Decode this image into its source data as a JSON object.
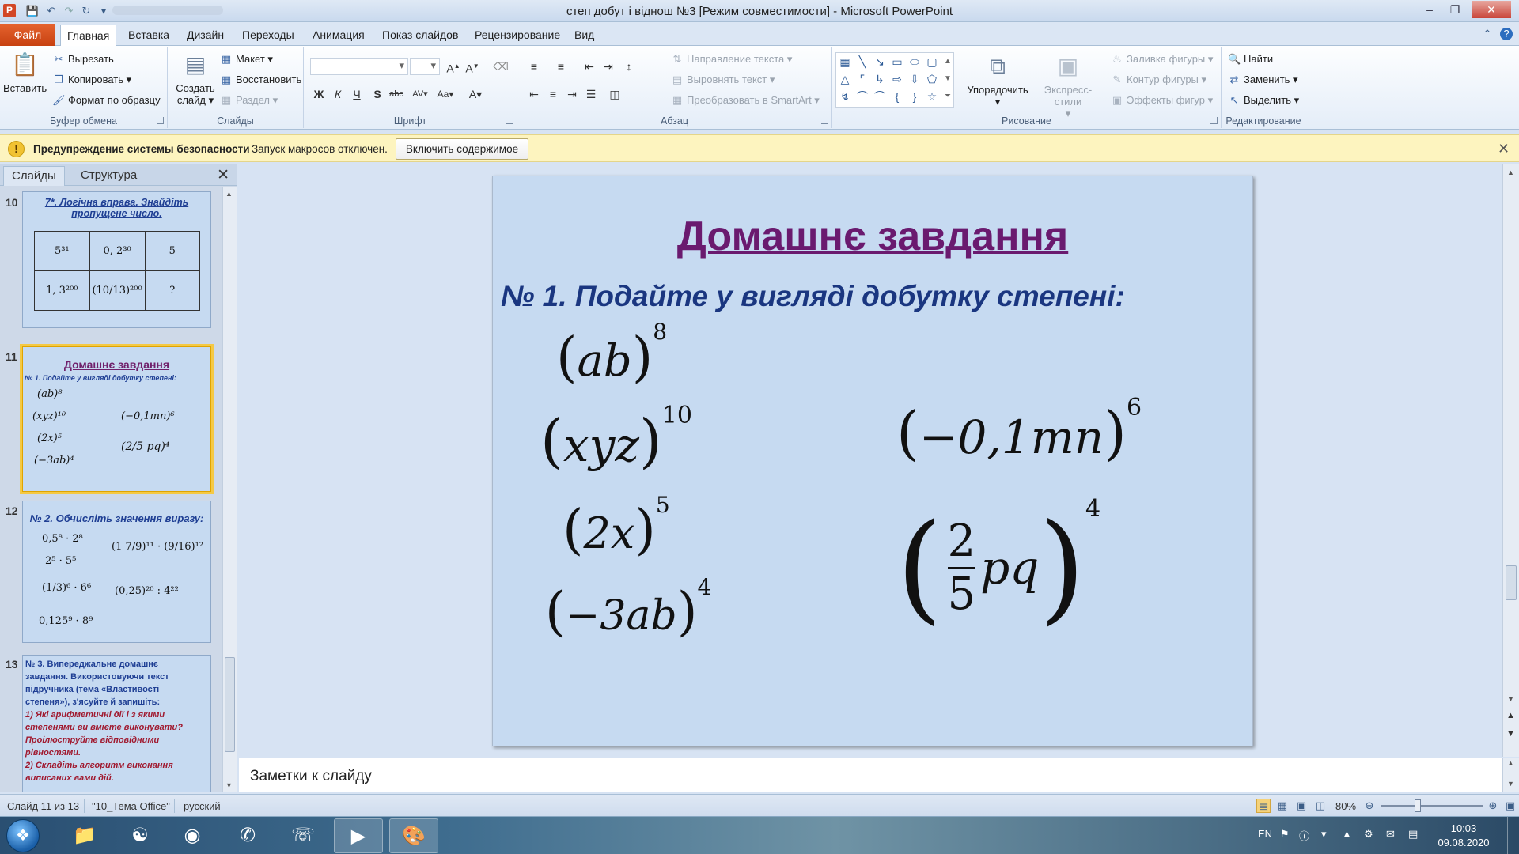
{
  "window": {
    "title": "степ добут і віднош №3 [Режим совместимости]  -  Microsoft PowerPoint",
    "app_letter": "P",
    "minimize": "–",
    "maximize": "❐",
    "close": "✕"
  },
  "tabs": {
    "file": "Файл",
    "items": [
      "Главная",
      "Вставка",
      "Дизайн",
      "Переходы",
      "Анимация",
      "Показ слайдов",
      "Рецензирование",
      "Вид"
    ]
  },
  "ribbon": {
    "clipboard": {
      "label": "Буфер обмена",
      "paste": "Вставить",
      "cut": "Вырезать",
      "copy": "Копировать",
      "format_painter": "Формат по образцу"
    },
    "slides": {
      "label": "Слайды",
      "new_slide_1": "Создать",
      "new_slide_2": "слайд",
      "layout": "Макет",
      "reset": "Восстановить",
      "section": "Раздел"
    },
    "font": {
      "label": "Шрифт"
    },
    "paragraph": {
      "label": "Абзац",
      "text_direction": "Направление текста",
      "align_text": "Выровнять текст",
      "smartart": "Преобразовать в SmartArt"
    },
    "drawing": {
      "label": "Рисование",
      "arrange": "Упорядочить",
      "quick_styles": "Экспресс-стили",
      "shape_fill": "Заливка фигуры",
      "shape_outline": "Контур фигуры",
      "shape_effects": "Эффекты фигур"
    },
    "editing": {
      "label": "Редактирование",
      "find": "Найти",
      "replace": "Заменить",
      "select": "Выделить"
    }
  },
  "security_bar": {
    "title": "Предупреждение системы безопасности",
    "message": "Запуск макросов отключен.",
    "button": "Включить содержимое"
  },
  "left_pane": {
    "tab_slides": "Слайды",
    "tab_outline": "Структура",
    "thumbnails": [
      {
        "num": "10",
        "title": "7*. Логічна вправа. Знайдіть пропущене число.",
        "cells": [
          [
            "5³¹",
            "0, 2³⁰",
            "5"
          ],
          [
            "1, 3²⁰⁰",
            "(10/13)²⁰⁰",
            "?"
          ]
        ]
      },
      {
        "num": "11",
        "title": "Домашнє завдання",
        "subtitle": "№ 1. Подайте у вигляді добутку степені:",
        "left": [
          "(ab)⁸",
          "(xyz)¹⁰",
          "(2x)⁵",
          "(−3ab)⁴"
        ],
        "right": [
          "(−0,1mn)⁶",
          "(2/5 pq)⁴"
        ]
      },
      {
        "num": "12",
        "title": "№ 2. Обчисліть значення виразу:",
        "left": [
          "0,5⁸ · 2⁸",
          "2⁵ · 5⁵",
          "(1/3)⁶ · 6⁶",
          "0,125⁹ · 8⁹"
        ],
        "right": [
          "(1 7/9)¹¹ · (9/16)¹²",
          "(0,25)²⁰ : 4²²"
        ]
      },
      {
        "num": "13",
        "lines": [
          "№ 3. Випереджальне домашнє",
          "завдання. Використовуючи текст",
          "підручника (тема «Властивості",
          "степеня»), з'ясуйте й запишіть:",
          "1) Які арифметичні дії і з якими",
          "степенями ви вмієте виконувати?",
          "Проілюструйте відповідними",
          "рівностями.",
          "2) Складіть алгоритм виконання",
          "виписаних вами дій."
        ]
      }
    ]
  },
  "slide": {
    "title": "Домашнє завдання",
    "subtitle": "№ 1. Подайте у вигляді добутку степені:",
    "expr": {
      "ab_base": "ab",
      "ab_exp": "8",
      "xyz_base": "xyz",
      "xyz_exp": "10",
      "twox_base": "2x",
      "twox_exp": "5",
      "m3ab_base": "−3ab",
      "m3ab_exp": "4",
      "mn_base": "−0,1mn",
      "mn_exp": "6",
      "frac_num": "2",
      "frac_den": "5",
      "frac_var": "pq",
      "frac_exp": "4"
    }
  },
  "notes": {
    "placeholder": "Заметки к слайду"
  },
  "status": {
    "slide": "Слайд 11 из 13",
    "theme": "\"10_Тема Office\"",
    "language": "русский",
    "zoom": "80%"
  },
  "tray": {
    "lang": "EN",
    "time": "10:03",
    "date": "09.08.2020"
  }
}
